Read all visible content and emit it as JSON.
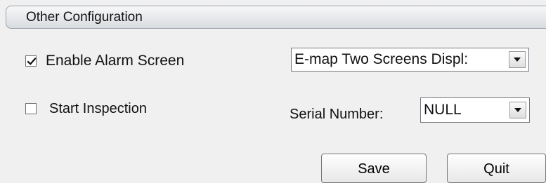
{
  "panel": {
    "title": "Other Configuration"
  },
  "options": {
    "enable_alarm_screen": {
      "label": "Enable Alarm Screen",
      "checked": true
    },
    "start_inspection": {
      "label": "Start Inspection",
      "checked": false
    }
  },
  "display_mode": {
    "selected": "E-map Two Screens Displ:",
    "icon": "chevron-down-icon"
  },
  "serial_number": {
    "label": "Serial Number:",
    "selected": "NULL",
    "icon": "chevron-down-icon"
  },
  "actions": {
    "save_label": "Save",
    "quit_label": "Quit"
  }
}
